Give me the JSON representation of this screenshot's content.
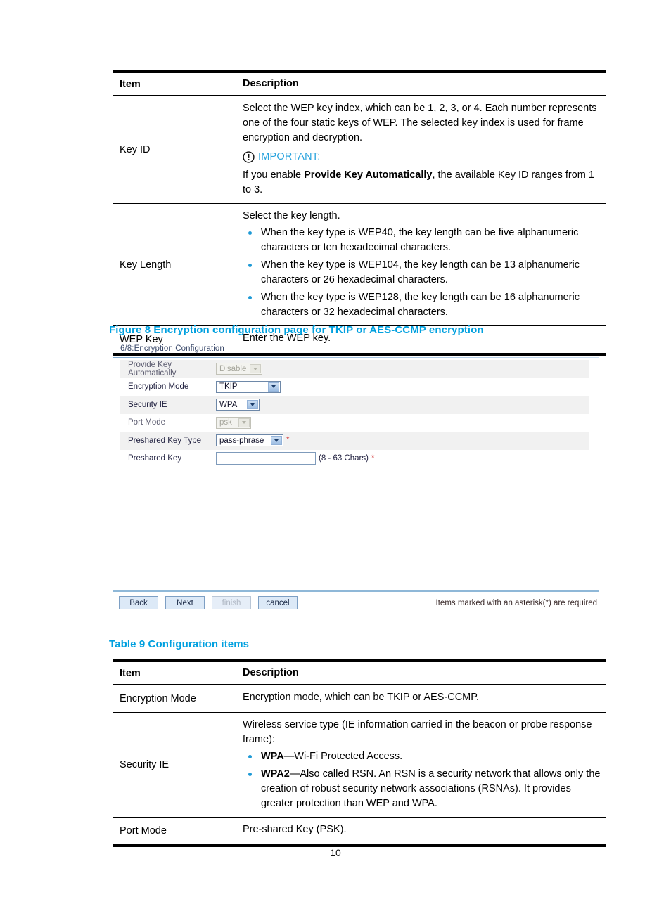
{
  "page": {
    "number": "10"
  },
  "colors": {
    "caption_blue": "#00a0df",
    "bullet_blue": "#1f9ad6",
    "important_blue": "#29a3dd",
    "required_red": "#d43f3f"
  },
  "table8": {
    "headers": {
      "item": "Item",
      "description": "Description"
    },
    "rows": [
      {
        "item": "Key ID",
        "desc_paragraphs": [
          "Select the WEP key index, which can be 1, 2, 3, or 4. Each number represents one of the four static keys of WEP. The selected key index is used for frame encryption and decryption."
        ],
        "important": {
          "icon": "important-icon",
          "label": "IMPORTANT:",
          "note_prefix": "If you enable ",
          "note_bold": "Provide Key Automatically",
          "note_suffix": ", the available Key ID ranges from 1 to 3."
        }
      },
      {
        "item": "Key Length",
        "desc_paragraphs": [
          "Select the key length."
        ],
        "bullets": [
          "When the key type is WEP40, the key length can be five alphanumeric characters or ten hexadecimal characters.",
          "When the key type is WEP104, the key length can be 13 alphanumeric characters or 26 hexadecimal characters.",
          "When the key type is WEP128, the key length can be 16 alphanumeric characters or 32 hexadecimal characters."
        ]
      },
      {
        "item": "WEP Key",
        "desc_paragraphs": [
          "Enter the WEP key."
        ]
      }
    ]
  },
  "figure8": {
    "caption": "Figure 8 Encryption configuration page for TKIP or AES-CCMP encryption",
    "screenshot": {
      "wizard_step_title": "6/8:Encryption Configuration",
      "fields": [
        {
          "label": "Provide Key Automatically",
          "control": "select",
          "value": "Disable",
          "disabled": true,
          "required": false
        },
        {
          "label": "Encryption Mode",
          "control": "select",
          "value": "TKIP",
          "disabled": false,
          "required": false
        },
        {
          "label": "Security IE",
          "control": "select",
          "value": "WPA",
          "disabled": false,
          "required": false
        },
        {
          "label": "Port Mode",
          "control": "select",
          "value": "psk",
          "disabled": true,
          "required": false
        },
        {
          "label": "Preshared Key Type",
          "control": "select",
          "value": "pass-phrase",
          "disabled": false,
          "required": true
        },
        {
          "label": "Preshared Key",
          "control": "text",
          "value": "",
          "hint": "(8 - 63 Chars)",
          "disabled": false,
          "required": true
        }
      ],
      "buttons": [
        {
          "label": "Back",
          "disabled": false
        },
        {
          "label": "Next",
          "disabled": false
        },
        {
          "label": "finish",
          "disabled": true
        },
        {
          "label": "cancel",
          "disabled": false
        }
      ],
      "footer_note": "Items marked with an asterisk(*) are required"
    }
  },
  "table9": {
    "caption": "Table 9 Configuration items",
    "headers": {
      "item": "Item",
      "description": "Description"
    },
    "rows": [
      {
        "item": "Encryption Mode",
        "desc_paragraphs": [
          "Encryption mode, which can be TKIP or AES-CCMP."
        ]
      },
      {
        "item": "Security IE",
        "desc_paragraphs": [
          "Wireless service type (IE information carried in the beacon or probe response frame):"
        ],
        "bullets": [
          {
            "bold": "WPA",
            "text": "—Wi-Fi Protected Access."
          },
          {
            "bold": "WPA2",
            "text": "—Also called RSN. An RSN is a security network that allows only the creation of robust security network associations (RSNAs). It provides greater protection than WEP and WPA."
          }
        ]
      },
      {
        "item": "Port Mode",
        "desc_paragraphs": [
          "Pre-shared Key (PSK)."
        ]
      }
    ]
  }
}
